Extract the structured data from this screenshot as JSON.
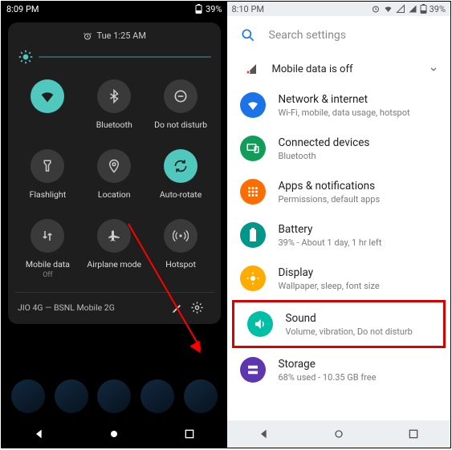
{
  "left": {
    "status": {
      "time": "8:09 PM",
      "battery": "39%"
    },
    "alarm": "Tue 1:25 AM",
    "tiles": [
      {
        "name": "wifi",
        "label": "",
        "on": true
      },
      {
        "name": "bluetooth",
        "label": "Bluetooth",
        "on": false
      },
      {
        "name": "dnd",
        "label": "Do not disturb",
        "on": false
      },
      {
        "name": "flashlight",
        "label": "Flashlight",
        "on": false
      },
      {
        "name": "location",
        "label": "Location",
        "on": false
      },
      {
        "name": "autorotate",
        "label": "Auto-rotate",
        "on": true
      },
      {
        "name": "mobiledata",
        "label": "Mobile data",
        "sub": "Off",
        "on": false
      },
      {
        "name": "airplane",
        "label": "Airplane mode",
        "on": false
      },
      {
        "name": "hotspot",
        "label": "Hotspot",
        "on": false
      }
    ],
    "carrier": "JIO 4G — BSNL Mobile 2G"
  },
  "right": {
    "status": {
      "time": "8:10 PM",
      "battery": "39%"
    },
    "search_placeholder": "Search settings",
    "mobile_data_banner": "Mobile data is off",
    "items": [
      {
        "key": "network",
        "title": "Network & internet",
        "sub": "Wi-Fi, mobile, data usage, hotspot",
        "color": "#1a73e8"
      },
      {
        "key": "devices",
        "title": "Connected devices",
        "sub": "Bluetooth",
        "color": "#0f9d58"
      },
      {
        "key": "apps",
        "title": "Apps & notifications",
        "sub": "Permissions, default apps",
        "color": "#ff6d00"
      },
      {
        "key": "battery",
        "title": "Battery",
        "sub": "39% - About 1 day, 1 hr left",
        "color": "#009688"
      },
      {
        "key": "display",
        "title": "Display",
        "sub": "Wallpaper, sleep, font size",
        "color": "#ffab00"
      },
      {
        "key": "sound",
        "title": "Sound",
        "sub": "Volume, vibration, Do not disturb",
        "color": "#00bfa5"
      },
      {
        "key": "storage",
        "title": "Storage",
        "sub": "68% used - 10.35 GB free",
        "color": "#5e35b1"
      }
    ]
  }
}
